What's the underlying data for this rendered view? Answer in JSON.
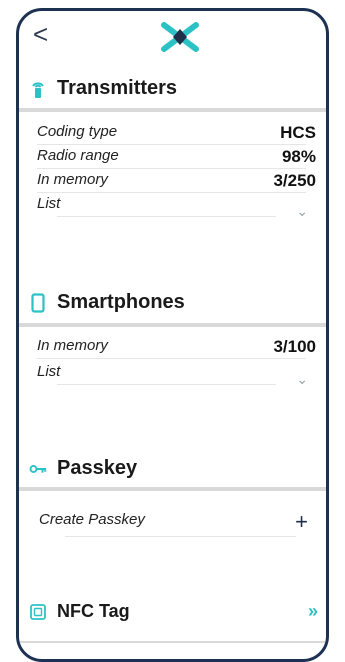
{
  "header": {
    "back_label": "<"
  },
  "transmitters": {
    "title": "Transmitters",
    "rows": [
      {
        "label": "Coding type",
        "value": "HCS"
      },
      {
        "label": "Radio range",
        "value": "98%"
      },
      {
        "label": "In memory",
        "value": "3/250"
      }
    ],
    "list_label": "List"
  },
  "smartphones": {
    "title": "Smartphones",
    "rows": [
      {
        "label": "In memory",
        "value": "3/100"
      }
    ],
    "list_label": "List"
  },
  "passkey": {
    "title": "Passkey",
    "create_label": "Create Passkey",
    "add_symbol": "+"
  },
  "nfc": {
    "title": "NFC Tag",
    "open_symbol": "»"
  },
  "colors": {
    "frame": "#1d3152",
    "accent_teal": "#2cc2c5",
    "navy": "#1f2f4a"
  }
}
